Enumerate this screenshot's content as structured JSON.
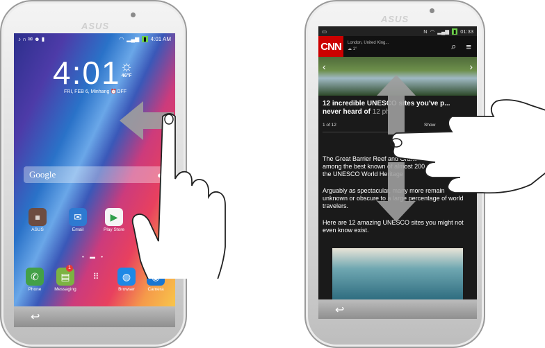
{
  "left_phone": {
    "brand": "ASUS",
    "status": {
      "time": "4:01 AM"
    },
    "clock": "4:01",
    "date_line": "FRI, FEB 6, Minhang",
    "alarm": "OFF",
    "weather": {
      "temp": "46°F",
      "icon": "sun-icon"
    },
    "search": {
      "placeholder": "Google"
    },
    "apps": [
      {
        "label": "ASUS",
        "icon": "asus-folder-icon",
        "color": "#8d6e63"
      },
      {
        "label": "Email",
        "icon": "email-icon",
        "color": "#2e7ad1"
      },
      {
        "label": "Play Store",
        "icon": "play-store-icon",
        "color": "#f5f5f5"
      }
    ],
    "dock": [
      {
        "label": "Phone",
        "icon": "phone-icon",
        "color": "#43a047"
      },
      {
        "label": "Messaging",
        "icon": "messaging-icon",
        "color": "#7cb342",
        "badge": "1"
      },
      {
        "label": "",
        "icon": "app-drawer-icon",
        "color": "transparent"
      },
      {
        "label": "Browser",
        "icon": "browser-icon",
        "color": "#1e88e5"
      },
      {
        "label": "Camera",
        "icon": "camera-icon",
        "color": "#1976d2"
      }
    ],
    "gesture": "swipe-left"
  },
  "right_phone": {
    "brand": "ASUS",
    "status": {
      "time": "01:33",
      "nfc": "N"
    },
    "cnn": {
      "logo": "CNN",
      "location": "London, United King...",
      "temp": "1°"
    },
    "headline": "12 incredible UNESCO sites you've p... never heard of",
    "headline_tail": "12 ph",
    "counter": "1 of 12",
    "show": "Show",
    "paragraphs": [
      "The Great Barrier Reef and Grand Canyon are among the best known of almost 200 natural sites on the UNESCO World Heritage",
      "Arguably as spectacular, many more remain unknown or obscure to a large percentage of world travelers.",
      "Here are 12 amazing UNESCO sites you might not even know exist."
    ],
    "gesture": "scroll-up-down"
  },
  "colors": {
    "cnn_red": "#cc0000",
    "arrow_gray": "#9e9e9e"
  }
}
